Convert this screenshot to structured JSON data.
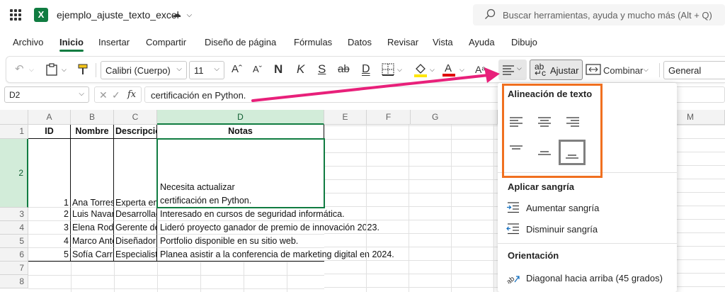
{
  "app": {
    "doc_title": "ejemplo_ajuste_texto_excel",
    "logo_letter": "X",
    "search_placeholder": "Buscar herramientas, ayuda y mucho más (Alt + Q)"
  },
  "menu": [
    "Archivo",
    "Inicio",
    "Insertar",
    "Compartir",
    "Diseño de página",
    "Fórmulas",
    "Datos",
    "Revisar",
    "Vista",
    "Ayuda",
    "Dibujo"
  ],
  "menu_active": "Inicio",
  "ribbon": {
    "font_name": "Calibri (Cuerpo)",
    "font_size": "11",
    "wrap_label": "Ajustar",
    "merge_label": "Combinar",
    "number_format": "General",
    "bold": "N",
    "italic": "K",
    "underline": "S",
    "double_underline": "D",
    "strikethrough": "ab"
  },
  "formula_bar": {
    "name_box": "D2",
    "fx": "fx",
    "content": "certificación en Python."
  },
  "columns": [
    "A",
    "B",
    "C",
    "D",
    "E",
    "F",
    "G",
    "M"
  ],
  "rows": [
    "1",
    "2",
    "3",
    "4",
    "5",
    "6",
    "7",
    "8"
  ],
  "sheet": {
    "header": [
      "ID",
      "Nombre",
      "Descripción",
      "Notas"
    ],
    "data": [
      {
        "id": "1",
        "nombre": "Ana Torres",
        "desc": "Experta en",
        "notas": [
          "Necesita actualizar",
          "certificación en Python."
        ]
      },
      {
        "id": "2",
        "nombre": "Luis Navarro",
        "desc": "Desarrollador",
        "notas": "Interesado en cursos de seguridad informática."
      },
      {
        "id": "3",
        "nombre": "Elena Rodríguez",
        "desc": "Gerente de",
        "notas": "Lideró proyecto ganador de premio de innovación 2023."
      },
      {
        "id": "4",
        "nombre": "Marco Antonio",
        "desc": "Diseñador",
        "notas": "Portfolio disponible en su sitio web."
      },
      {
        "id": "5",
        "nombre": "Sofía Carrillo",
        "desc": "Especialista",
        "notas": "Planea asistir a la conferencia de marketing digital en 2024."
      }
    ]
  },
  "panel": {
    "alignment_title": "Alineación de texto",
    "indent_title": "Aplicar sangría",
    "increase_indent": "Aumentar sangría",
    "decrease_indent": "Disminuir sangría",
    "orientation_title": "Orientación",
    "diagonal_up": "Diagonal hacia arriba (45 grados)"
  },
  "colors": {
    "excel_green": "#107c41",
    "highlight_arrow": "#e8207a",
    "callout_box": "#f07020",
    "font_color_bar": "#e00000",
    "highlight_color_bar": "#ffe600"
  }
}
